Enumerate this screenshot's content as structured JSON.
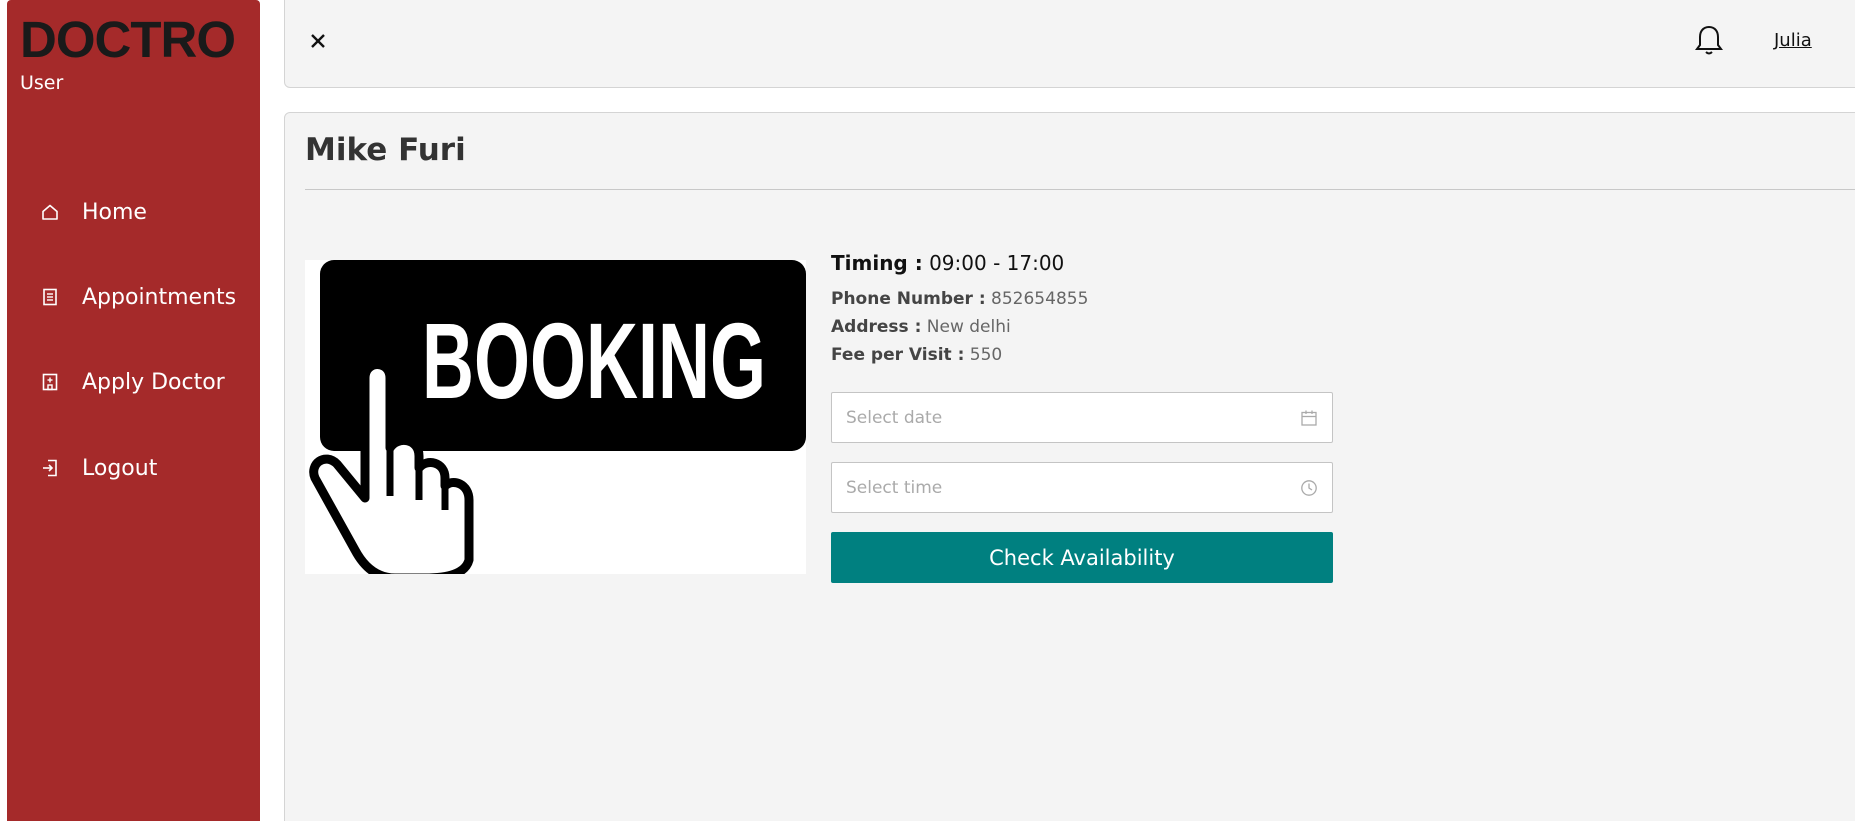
{
  "sidebar": {
    "brand": "DOCTRO",
    "role": "User",
    "items": [
      {
        "label": "Home",
        "icon": "home-icon"
      },
      {
        "label": "Appointments",
        "icon": "document-icon"
      },
      {
        "label": "Apply Doctor",
        "icon": "hospital-icon"
      },
      {
        "label": "Logout",
        "icon": "logout-icon"
      }
    ]
  },
  "header": {
    "close_icon": "close-icon",
    "notification_icon": "bell-icon",
    "user_name": "Julia"
  },
  "doctor": {
    "name": "Mike Furi",
    "timing_label": "Timing :",
    "timing_value": "09:00 - 17:00",
    "phone_label": "Phone Number :",
    "phone_value": "852654855",
    "address_label": "Address :",
    "address_value": "New delhi",
    "fee_label": "Fee per Visit :",
    "fee_value": "550"
  },
  "image": {
    "text": "BOOKING"
  },
  "form": {
    "date_placeholder": "Select date",
    "time_placeholder": "Select time",
    "check_label": "Check Availability"
  },
  "colors": {
    "sidebar_bg": "#a52a2a",
    "button_bg": "#008080",
    "panel_bg": "#f4f4f4"
  }
}
